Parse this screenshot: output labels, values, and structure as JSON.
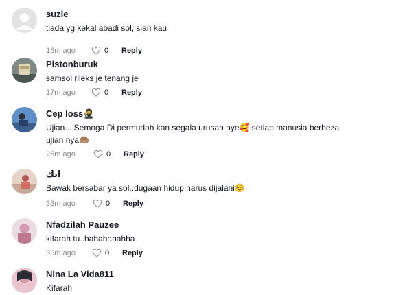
{
  "comments": [
    {
      "name": "suzie",
      "text": "tiada yg kekal abadi sol, sian kau",
      "time": "15m ago",
      "likes": "0",
      "reply": "Reply",
      "avatar": "default-avatar"
    },
    {
      "name": "Pistonburuk",
      "text": "samsol rileks je tenang je",
      "time": "17m ago",
      "likes": "0",
      "reply": "Reply",
      "avatar": "photo-avatar"
    },
    {
      "name": "Cep loss🥷",
      "text": "Ujian... Semoga Di permudah kan segala urusan nye🥰 setiap manusia berbeza",
      "text2": "ujian nya🤲🏽",
      "time": "25m ago",
      "likes": "0",
      "reply": "Reply",
      "avatar": "photo-avatar"
    },
    {
      "name": "ايك",
      "text": "Bawak bersabar ya sol..dugaan hidup harus dijalani☺️",
      "time": "33m ago",
      "likes": "0",
      "reply": "Reply",
      "avatar": "photo-avatar"
    },
    {
      "name": "Nfadzilah Pauzee",
      "text": "kifarah tu..hahahahahha",
      "time": "35m ago",
      "likes": "0",
      "reply": "Reply",
      "avatar": "photo-avatar"
    },
    {
      "name": "Nina La Vida811",
      "text": "Kifarah",
      "avatar": "photo-avatar"
    }
  ]
}
